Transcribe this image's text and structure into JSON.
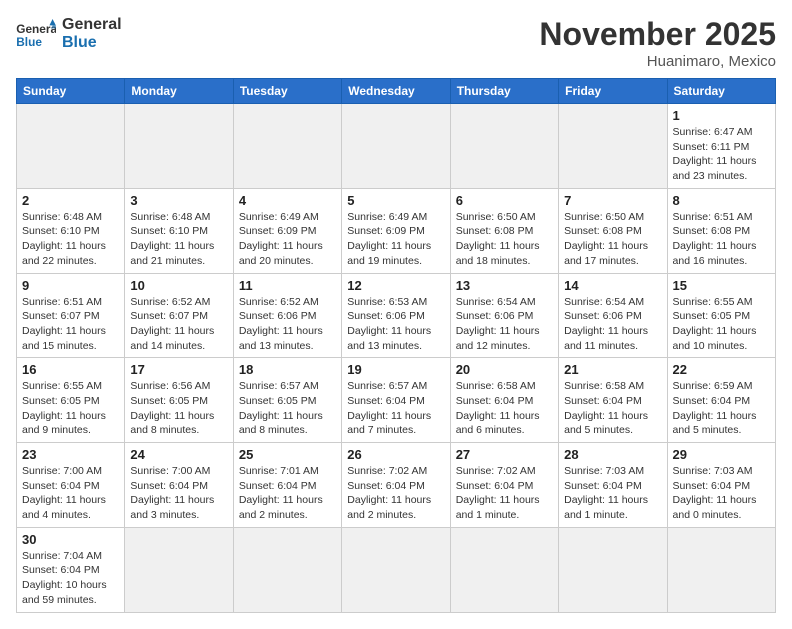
{
  "header": {
    "title": "November 2025",
    "location": "Huanimaro, Mexico",
    "logo_general": "General",
    "logo_blue": "Blue"
  },
  "days_of_week": [
    "Sunday",
    "Monday",
    "Tuesday",
    "Wednesday",
    "Thursday",
    "Friday",
    "Saturday"
  ],
  "weeks": [
    [
      {
        "day": "",
        "empty": true
      },
      {
        "day": "",
        "empty": true
      },
      {
        "day": "",
        "empty": true
      },
      {
        "day": "",
        "empty": true
      },
      {
        "day": "",
        "empty": true
      },
      {
        "day": "",
        "empty": true
      },
      {
        "day": "1",
        "sunrise": "6:47 AM",
        "sunset": "6:11 PM",
        "daylight": "11 hours and 23 minutes."
      }
    ],
    [
      {
        "day": "2",
        "sunrise": "6:48 AM",
        "sunset": "6:10 PM",
        "daylight": "11 hours and 22 minutes."
      },
      {
        "day": "3",
        "sunrise": "6:48 AM",
        "sunset": "6:10 PM",
        "daylight": "11 hours and 21 minutes."
      },
      {
        "day": "4",
        "sunrise": "6:49 AM",
        "sunset": "6:09 PM",
        "daylight": "11 hours and 20 minutes."
      },
      {
        "day": "5",
        "sunrise": "6:49 AM",
        "sunset": "6:09 PM",
        "daylight": "11 hours and 19 minutes."
      },
      {
        "day": "6",
        "sunrise": "6:50 AM",
        "sunset": "6:08 PM",
        "daylight": "11 hours and 18 minutes."
      },
      {
        "day": "7",
        "sunrise": "6:50 AM",
        "sunset": "6:08 PM",
        "daylight": "11 hours and 17 minutes."
      },
      {
        "day": "8",
        "sunrise": "6:51 AM",
        "sunset": "6:08 PM",
        "daylight": "11 hours and 16 minutes."
      }
    ],
    [
      {
        "day": "9",
        "sunrise": "6:51 AM",
        "sunset": "6:07 PM",
        "daylight": "11 hours and 15 minutes."
      },
      {
        "day": "10",
        "sunrise": "6:52 AM",
        "sunset": "6:07 PM",
        "daylight": "11 hours and 14 minutes."
      },
      {
        "day": "11",
        "sunrise": "6:52 AM",
        "sunset": "6:06 PM",
        "daylight": "11 hours and 13 minutes."
      },
      {
        "day": "12",
        "sunrise": "6:53 AM",
        "sunset": "6:06 PM",
        "daylight": "11 hours and 13 minutes."
      },
      {
        "day": "13",
        "sunrise": "6:54 AM",
        "sunset": "6:06 PM",
        "daylight": "11 hours and 12 minutes."
      },
      {
        "day": "14",
        "sunrise": "6:54 AM",
        "sunset": "6:06 PM",
        "daylight": "11 hours and 11 minutes."
      },
      {
        "day": "15",
        "sunrise": "6:55 AM",
        "sunset": "6:05 PM",
        "daylight": "11 hours and 10 minutes."
      }
    ],
    [
      {
        "day": "16",
        "sunrise": "6:55 AM",
        "sunset": "6:05 PM",
        "daylight": "11 hours and 9 minutes."
      },
      {
        "day": "17",
        "sunrise": "6:56 AM",
        "sunset": "6:05 PM",
        "daylight": "11 hours and 8 minutes."
      },
      {
        "day": "18",
        "sunrise": "6:57 AM",
        "sunset": "6:05 PM",
        "daylight": "11 hours and 8 minutes."
      },
      {
        "day": "19",
        "sunrise": "6:57 AM",
        "sunset": "6:04 PM",
        "daylight": "11 hours and 7 minutes."
      },
      {
        "day": "20",
        "sunrise": "6:58 AM",
        "sunset": "6:04 PM",
        "daylight": "11 hours and 6 minutes."
      },
      {
        "day": "21",
        "sunrise": "6:58 AM",
        "sunset": "6:04 PM",
        "daylight": "11 hours and 5 minutes."
      },
      {
        "day": "22",
        "sunrise": "6:59 AM",
        "sunset": "6:04 PM",
        "daylight": "11 hours and 5 minutes."
      }
    ],
    [
      {
        "day": "23",
        "sunrise": "7:00 AM",
        "sunset": "6:04 PM",
        "daylight": "11 hours and 4 minutes."
      },
      {
        "day": "24",
        "sunrise": "7:00 AM",
        "sunset": "6:04 PM",
        "daylight": "11 hours and 3 minutes."
      },
      {
        "day": "25",
        "sunrise": "7:01 AM",
        "sunset": "6:04 PM",
        "daylight": "11 hours and 2 minutes."
      },
      {
        "day": "26",
        "sunrise": "7:02 AM",
        "sunset": "6:04 PM",
        "daylight": "11 hours and 2 minutes."
      },
      {
        "day": "27",
        "sunrise": "7:02 AM",
        "sunset": "6:04 PM",
        "daylight": "11 hours and 1 minute."
      },
      {
        "day": "28",
        "sunrise": "7:03 AM",
        "sunset": "6:04 PM",
        "daylight": "11 hours and 1 minute."
      },
      {
        "day": "29",
        "sunrise": "7:03 AM",
        "sunset": "6:04 PM",
        "daylight": "11 hours and 0 minutes."
      }
    ],
    [
      {
        "day": "30",
        "sunrise": "7:04 AM",
        "sunset": "6:04 PM",
        "daylight": "10 hours and 59 minutes."
      },
      {
        "day": "",
        "empty": true
      },
      {
        "day": "",
        "empty": true
      },
      {
        "day": "",
        "empty": true
      },
      {
        "day": "",
        "empty": true
      },
      {
        "day": "",
        "empty": true
      },
      {
        "day": "",
        "empty": true
      }
    ]
  ]
}
